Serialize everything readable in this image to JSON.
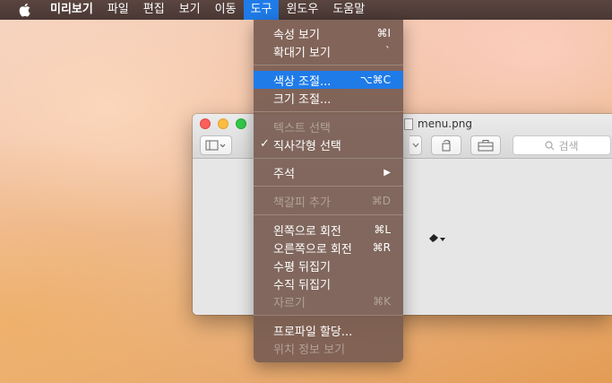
{
  "menubar": {
    "apple_icon": "apple-logo-icon",
    "app_name": "미리보기",
    "items": [
      "파일",
      "편집",
      "보기",
      "이동",
      "도구",
      "윈도우",
      "도움말"
    ]
  },
  "window": {
    "title": "menu.png",
    "search_placeholder": "검색"
  },
  "tools_menu": {
    "items": [
      {
        "label": "속성 보기",
        "shortcut": "⌘I"
      },
      {
        "label": "확대기 보기",
        "shortcut": "`"
      },
      {
        "label": "색상 조절...",
        "shortcut": "⌥⌘C"
      },
      {
        "label": "크기 조절...",
        "shortcut": ""
      },
      {
        "label": "텍스트 선택",
        "shortcut": ""
      },
      {
        "label": "직사각형 선택",
        "shortcut": "",
        "checked": true
      },
      {
        "label": "주석",
        "shortcut": "▶"
      },
      {
        "label": "책갈피 추가",
        "shortcut": "⌘D"
      },
      {
        "label": "왼쪽으로 회전",
        "shortcut": "⌘L"
      },
      {
        "label": "오른쪽으로 회전",
        "shortcut": "⌘R"
      },
      {
        "label": "수평 뒤집기",
        "shortcut": ""
      },
      {
        "label": "수직 뒤집기",
        "shortcut": ""
      },
      {
        "label": "자르기",
        "shortcut": "⌘K"
      },
      {
        "label": "프로파일 할당...",
        "shortcut": ""
      },
      {
        "label": "위치 정보 보기",
        "shortcut": ""
      }
    ],
    "check_mark": "✓"
  },
  "colors": {
    "menubar_bg": "#4f3c37",
    "highlight": "#1f7be8",
    "menu_bg": "#785c52"
  }
}
